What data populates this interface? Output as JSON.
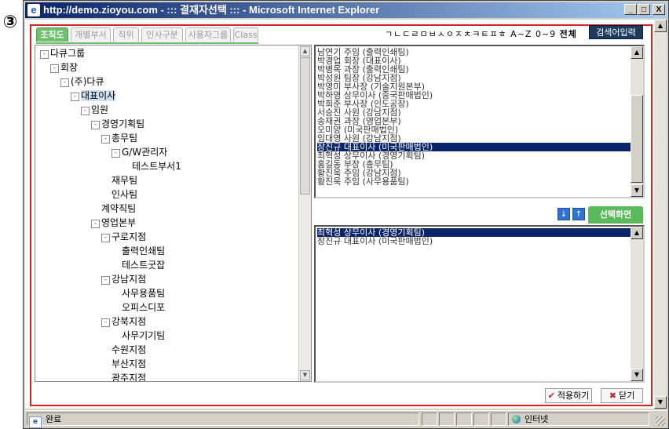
{
  "step_marker": "③",
  "window": {
    "title": "http://demo.zioyou.com - ::: 결재자선택 ::: - Microsoft Internet Explorer",
    "minimize": "_",
    "maximize": "□",
    "close": "X"
  },
  "tabs": [
    {
      "label": "조직도",
      "active": true
    },
    {
      "label": "개별부서",
      "active": false
    },
    {
      "label": "직위",
      "active": false
    },
    {
      "label": "인사구분",
      "active": false
    },
    {
      "label": "사용자그룹",
      "active": false
    },
    {
      "label": "Class",
      "active": false
    }
  ],
  "alpha_filter": {
    "letters": "ㄱㄴㄷㄹㅁㅂㅅㅇㅈㅊㅋㅌㅍㅎ A~Z 0~9",
    "all": "전체"
  },
  "search_button": "검색어입력",
  "tree": [
    {
      "label": "다큐그룹",
      "level": 0,
      "toggle": "-"
    },
    {
      "label": "회장",
      "level": 1,
      "toggle": "-"
    },
    {
      "label": "(주)다큐",
      "level": 2,
      "toggle": "-"
    },
    {
      "label": "대표이사",
      "level": 3,
      "toggle": "-",
      "selected": true
    },
    {
      "label": "임원",
      "level": 4,
      "toggle": "-"
    },
    {
      "label": "경영기획팀",
      "level": 5,
      "toggle": "-"
    },
    {
      "label": "총무팀",
      "level": 6,
      "toggle": "-"
    },
    {
      "label": "G/W관리자",
      "level": 7,
      "toggle": "-"
    },
    {
      "label": "테스트부서1",
      "level": 8,
      "toggle": ""
    },
    {
      "label": "재무팀",
      "level": 6,
      "toggle": ""
    },
    {
      "label": "인사팀",
      "level": 6,
      "toggle": ""
    },
    {
      "label": "계약직팀",
      "level": 5,
      "toggle": ""
    },
    {
      "label": "영업본부",
      "level": 5,
      "toggle": "-"
    },
    {
      "label": "구로지점",
      "level": 6,
      "toggle": "-"
    },
    {
      "label": "출력인쇄팀",
      "level": 7,
      "toggle": ""
    },
    {
      "label": "테스트굿잡",
      "level": 7,
      "toggle": ""
    },
    {
      "label": "강남지점",
      "level": 6,
      "toggle": "-"
    },
    {
      "label": "사무용품팀",
      "level": 7,
      "toggle": ""
    },
    {
      "label": "오피스디포",
      "level": 7,
      "toggle": ""
    },
    {
      "label": "강북지점",
      "level": 6,
      "toggle": "-"
    },
    {
      "label": "사무기기팀",
      "level": 7,
      "toggle": ""
    },
    {
      "label": "수원지점",
      "level": 6,
      "toggle": ""
    },
    {
      "label": "부산지점",
      "level": 6,
      "toggle": ""
    },
    {
      "label": "광주지점",
      "level": 6,
      "toggle": ""
    }
  ],
  "user_list": [
    {
      "label": "남연기 주임 (출력인쇄팀)"
    },
    {
      "label": "박경업 회장 (대표이사)"
    },
    {
      "label": "박병목 과장 (출력인쇄팀)"
    },
    {
      "label": "박성원 팀장 (강남지점)"
    },
    {
      "label": "박영미 부사장 (기술지원본부)"
    },
    {
      "label": "박하영 상무이사 (중국판매법인)"
    },
    {
      "label": "박희준 부사장 (인도공장)"
    },
    {
      "label": "서승진 사원 (강남지점)"
    },
    {
      "label": "송재권 과장 (영업본부)"
    },
    {
      "label": "오미양 (미국판매법인)"
    },
    {
      "label": "임대영 사원 (강남지점)"
    },
    {
      "label": "장진규 대표이사 (미국판매법인)",
      "selected": true
    },
    {
      "label": "최혁성 상무이사 (경영기획팀)"
    },
    {
      "label": "홍길동 부장 (총무팀)"
    },
    {
      "label": "황진욱 주임 (강남지점)"
    },
    {
      "label": "황진욱 주임 (사무용품팀)"
    }
  ],
  "move_up": "↑",
  "move_down": "↓",
  "select_screen_tab": "선택화면",
  "selected_list": [
    {
      "label": "최혁성 상무이사 (경영기획팀)",
      "selected": true
    },
    {
      "label": "장진규 대표이사 (미국판매법인)"
    }
  ],
  "apply_button": {
    "icon": "✔",
    "label": "적용하기"
  },
  "close_button": {
    "icon": "✖",
    "label": "닫기"
  },
  "status": {
    "text": "완료",
    "zone": "인터넷"
  }
}
